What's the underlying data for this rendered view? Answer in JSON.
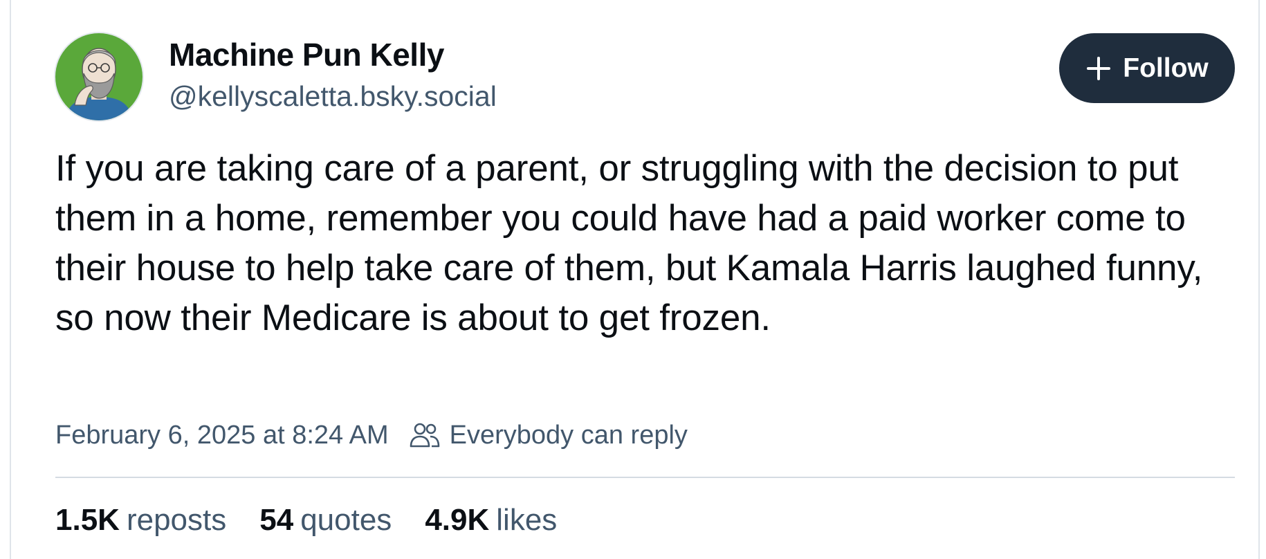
{
  "author": {
    "display_name": "Machine Pun Kelly",
    "handle": "@kellyscaletta.bsky.social",
    "avatar_icon": "cartoon-bearded-man-avatar"
  },
  "follow_button": {
    "label": "Follow",
    "icon": "plus-icon"
  },
  "post": {
    "text": "If you are taking care of a parent, or struggling with the decision to put them in a home, remember you could have had a paid worker come to their house to help take care of them, but Kamala Harris laughed funny, so now their Medicare is about to get frozen."
  },
  "meta": {
    "timestamp": "February 6, 2025 at 8:24 AM",
    "reply_setting": "Everybody can reply",
    "reply_icon": "people-icon"
  },
  "stats": {
    "reposts_count": "1.5K",
    "reposts_label": "reposts",
    "quotes_count": "54",
    "quotes_label": "quotes",
    "likes_count": "4.9K",
    "likes_label": "likes"
  },
  "colors": {
    "follow_button_bg": "#1f2d3d",
    "secondary_text": "#42576c",
    "primary_text": "#0b0f14",
    "avatar_bg": "#5aa83a"
  }
}
